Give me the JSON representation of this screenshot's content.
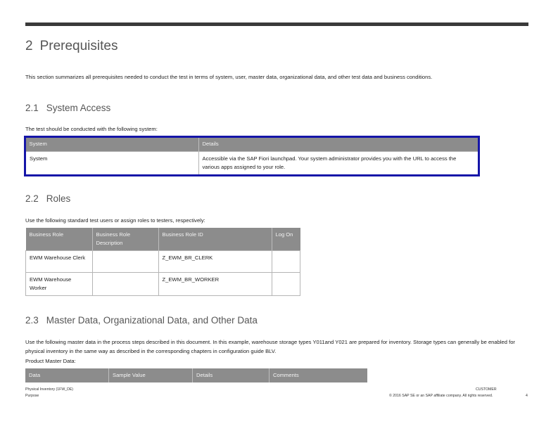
{
  "chapter": {
    "number": "2",
    "title": "Prerequisites"
  },
  "intro": "This section summarizes all prerequisites needed to conduct the test in terms of system, user, master data, organizational data, and other test data and business conditions.",
  "system_access": {
    "number": "2.1",
    "title": "System Access",
    "lead": "The test should be conducted with the following system:",
    "headers": [
      "System",
      "Details"
    ],
    "rows": [
      [
        "System",
        "Accessible via the SAP Fiori launchpad. Your system administrator provides you with the URL to access the various apps assigned to your role."
      ]
    ]
  },
  "roles": {
    "number": "2.2",
    "title": "Roles",
    "lead": "Use the following standard test users or assign roles to testers, respectively:",
    "headers": [
      "Business Role",
      "Business Role Description",
      "Business Role ID",
      "Log On"
    ],
    "rows": [
      [
        "EWM Warehouse Clerk",
        "",
        "Z_EWM_BR_CLERK",
        ""
      ],
      [
        "EWM Warehouse Worker",
        "",
        "Z_EWM_BR_WORKER",
        ""
      ]
    ]
  },
  "master_data": {
    "number": "2.3",
    "title": "Master Data, Organizational Data, and Other Data",
    "lead": "Use the following master data in the process steps described in this document. In this example, warehouse storage types Y011and Y021 are prepared for inventory. Storage types can generally be enabled for physical inventory in the same way as described in the corresponding chapters in configuration guide BLV.",
    "sublabel": "Product Master Data:",
    "headers": [
      "Data",
      "Sample Value",
      "Details",
      "Comments"
    ]
  },
  "footer": {
    "doc_title": "Physical Inventory (1FW_DE)",
    "section": "Purpose",
    "classification": "CUSTOMER",
    "copyright": "© 2016 SAP SE or an SAP affiliate company. All rights reserved.",
    "page": "4"
  }
}
